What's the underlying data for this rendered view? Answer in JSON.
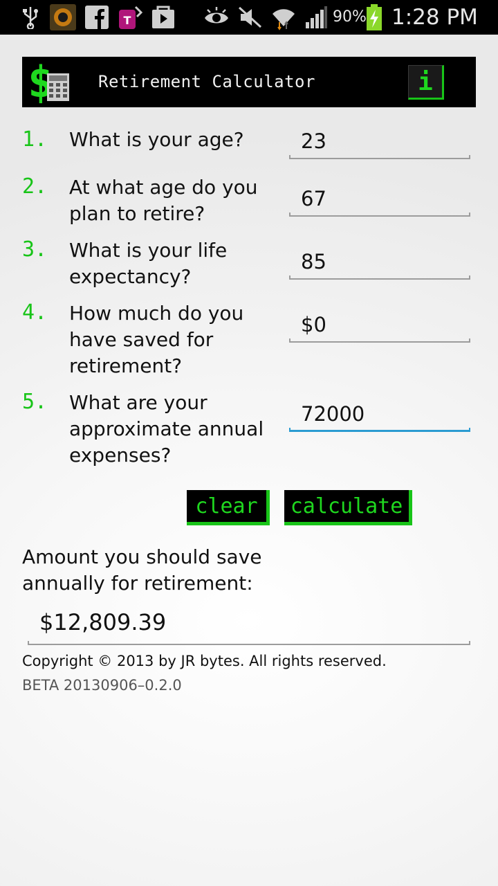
{
  "statusbar": {
    "battery": "90%",
    "time": "1:28 PM",
    "icons": [
      "usb-icon",
      "sun-app-icon",
      "facebook-icon",
      "t-mobile-icon",
      "play-store-icon",
      "eye-icon",
      "mute-icon",
      "wifi-icon",
      "signal-icon",
      "battery-charging-icon"
    ]
  },
  "header": {
    "title": "Retirement Calculator",
    "info_label": "i"
  },
  "questions": [
    {
      "num": "1.",
      "text": "What is your age?",
      "value": "23"
    },
    {
      "num": "2.",
      "text": "At what age do you plan to retire?",
      "value": "67"
    },
    {
      "num": "3.",
      "text": "What is your life expectancy?",
      "value": "85"
    },
    {
      "num": "4.",
      "text": "How much do you have saved for retirement?",
      "value": "$0"
    },
    {
      "num": "5.",
      "text": "What are your approximate annual expenses?",
      "value": "72000"
    }
  ],
  "buttons": {
    "clear": "clear",
    "calculate": "calculate"
  },
  "result": {
    "label": "Amount you should save annually for retirement:",
    "value": "$12,809.39"
  },
  "footer": {
    "copyright": "Copyright © 2013 by JR bytes. All rights reserved.",
    "version": "BETA 20130906–0.2.0"
  },
  "colors": {
    "accent_green": "#18c418",
    "active_field": "#2a9bd1"
  }
}
